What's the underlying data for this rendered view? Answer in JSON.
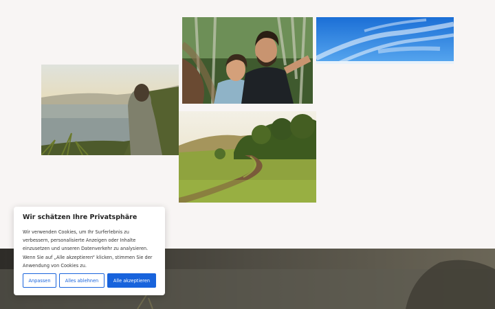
{
  "cookie_banner": {
    "title": "Wir schätzen Ihre Privatsphäre",
    "text": "Wir verwenden Cookies, um Ihr Surferlebnis zu verbessern, personalisierte Anzeigen oder Inhalte einzusetzen und unseren Datenverkehr zu analysieren. Wenn Sie auf „Alle akzeptieren“ klicken, stimmen Sie der Anwendung von Cookies zu.",
    "buttons": {
      "customize": "Anpassen",
      "reject_all": "Alles ablehnen",
      "accept_all": "Alle akzeptieren"
    }
  },
  "colors": {
    "page_background": "#f8f5f4",
    "accent": "#1863dc"
  }
}
